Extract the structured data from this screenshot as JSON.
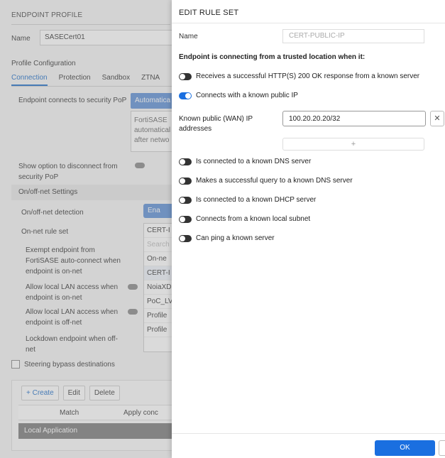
{
  "background": {
    "title": "ENDPOINT PROFILE",
    "name_label": "Name",
    "name_value": "SASECert01",
    "section_label": "Profile Configuration",
    "tabs": [
      "Connection",
      "Protection",
      "Sandbox",
      "ZTNA"
    ],
    "connects_label": "Endpoint connects to security PoP",
    "auto_btn": "Automatica",
    "auto_desc": "FortiSASE automatical after netwo",
    "show_option_label": "Show option to disconnect from security PoP",
    "onoff_settings": "On/off-net Settings",
    "onoff_detection": "On/off-net detection",
    "enable_btn": "Ena",
    "onnet_rule_set": "On-net rule set",
    "exempt_label": "Exempt endpoint from FortiSASE auto-connect when endpoint is on-net",
    "allow_lan_on": "Allow local LAN access when endpoint is on-net",
    "allow_lan_off": "Allow local LAN access when endpoint is off-net",
    "lockdown_label": "Lockdown endpoint when off-net",
    "dropdown_items": [
      "CERT-I",
      "Search",
      "On-ne",
      "CERT-I",
      "NoiaXD",
      "PoC_LV",
      "Profile",
      "Profile"
    ],
    "steering": "Steering bypass destinations",
    "tool_create": "+ Create",
    "tool_edit": "Edit",
    "tool_delete": "Delete",
    "col_match": "Match",
    "col_apply": "Apply conc",
    "local_app": "Local Application"
  },
  "modal": {
    "title": "EDIT RULE SET",
    "name_label": "Name",
    "name_value": "CERT-PUBLIC-IP",
    "section_heading": "Endpoint is connecting from a trusted location when it:",
    "options": [
      {
        "label": "Receives a successful HTTP(S) 200 OK response from a known server",
        "enabled": false
      },
      {
        "label": "Connects with a known public IP",
        "enabled": true
      },
      {
        "label": "Is connected to a known DNS server",
        "enabled": false
      },
      {
        "label": "Makes a successful query to a known DNS server",
        "enabled": false
      },
      {
        "label": "Is connected to a known DHCP server",
        "enabled": false
      },
      {
        "label": "Connects from a known local subnet",
        "enabled": false
      },
      {
        "label": "Can ping a known server",
        "enabled": false
      }
    ],
    "ip_label": "Known public (WAN) IP addresses",
    "ip_value": "100.20.20.20/32",
    "remove_symbol": "✕",
    "add_symbol": "+",
    "ok_label": "OK"
  },
  "colors": {
    "accent": "#1a6fe0",
    "toggle_off": "#333333"
  }
}
